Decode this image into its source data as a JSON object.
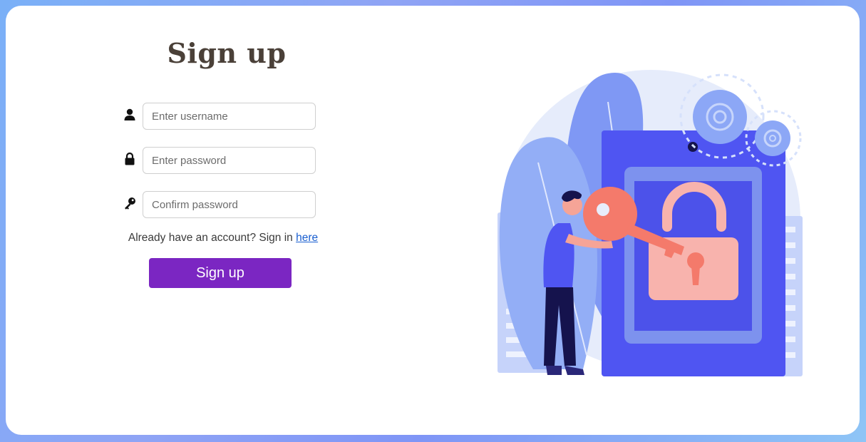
{
  "form": {
    "title": "Sign up",
    "username_placeholder": "Enter username",
    "password_placeholder": "Enter password",
    "confirm_placeholder": "Confirm password",
    "signin_prefix": "Already have an account? Sign in",
    "signin_link": "here",
    "submit_label": "Sign up"
  },
  "icons": {
    "username": "user-icon",
    "password": "lock-icon",
    "confirm": "key-icon"
  },
  "colors": {
    "accent": "#7b26c2",
    "link": "#1a5fd0",
    "illustration_primary": "#4f55f2",
    "illustration_key": "#f47a6b"
  }
}
